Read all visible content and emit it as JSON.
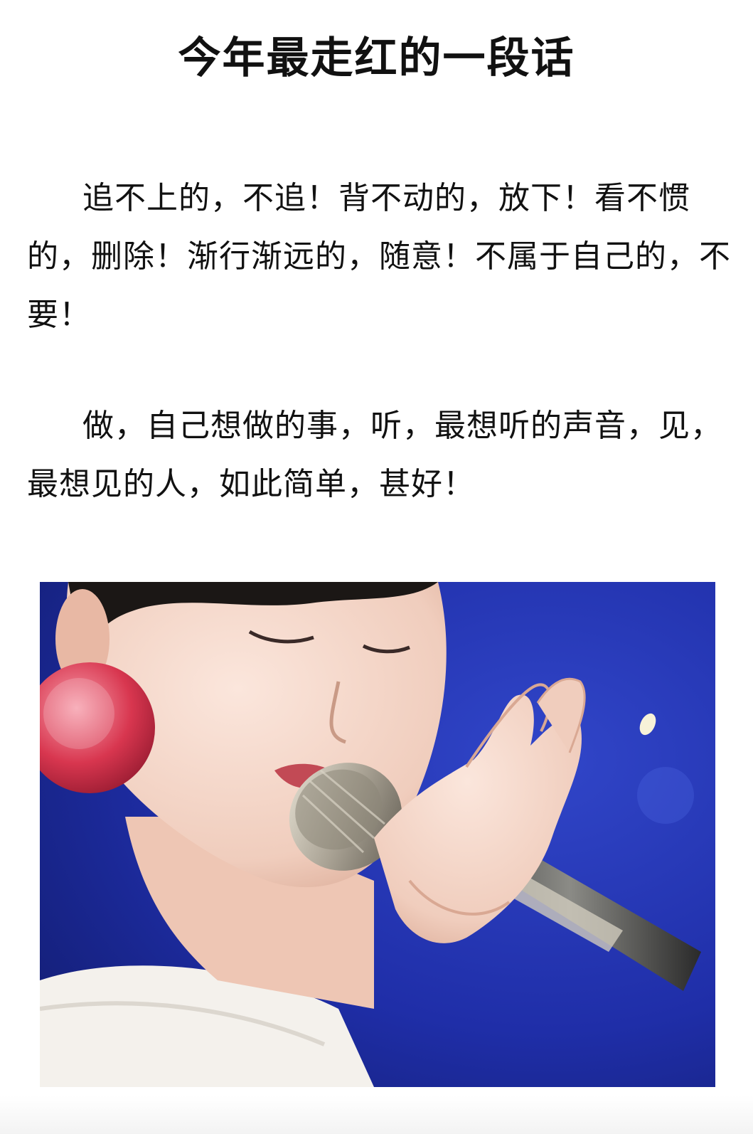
{
  "header": {
    "title": "今年最走红的一段话"
  },
  "body": {
    "paragraphs": [
      "追不上的，不追！背不动的，放下！看不惯的，删除！渐行渐远的，随意！不属于自己的，不要！",
      "做，自己想做的事，听，最想听的声音，见，最想见的人，如此简单，甚好！"
    ]
  },
  "photo": {
    "subject": "singer-with-microphone",
    "colors": {
      "stage_background": "#1f2ea8",
      "skin": "#f2d3c4",
      "earring": "#d8364f",
      "shirt": "#f4f1ec",
      "microphone": "#b9b3a6"
    }
  }
}
